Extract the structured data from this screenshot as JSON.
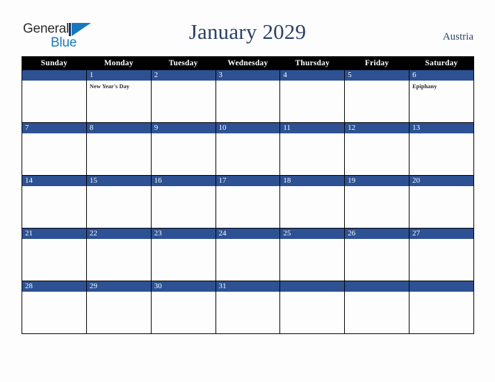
{
  "brand": {
    "name_part1": "General",
    "name_part2": "Blue",
    "logo_icon": "triangle-flag-icon",
    "color_dark": "#2b2b2b",
    "color_blue": "#1878be"
  },
  "header": {
    "title": "January 2029",
    "country": "Austria",
    "title_color": "#2b4166"
  },
  "calendar": {
    "month": "January",
    "year": "2029",
    "accent_color": "#2d5193",
    "header_bg": "#000000",
    "weekday_headers": [
      "Sunday",
      "Monday",
      "Tuesday",
      "Wednesday",
      "Thursday",
      "Friday",
      "Saturday"
    ],
    "weeks": [
      [
        {
          "date": "",
          "events": []
        },
        {
          "date": "1",
          "events": [
            "New Year's Day"
          ]
        },
        {
          "date": "2",
          "events": []
        },
        {
          "date": "3",
          "events": []
        },
        {
          "date": "4",
          "events": []
        },
        {
          "date": "5",
          "events": []
        },
        {
          "date": "6",
          "events": [
            "Epiphany"
          ]
        }
      ],
      [
        {
          "date": "7",
          "events": []
        },
        {
          "date": "8",
          "events": []
        },
        {
          "date": "9",
          "events": []
        },
        {
          "date": "10",
          "events": []
        },
        {
          "date": "11",
          "events": []
        },
        {
          "date": "12",
          "events": []
        },
        {
          "date": "13",
          "events": []
        }
      ],
      [
        {
          "date": "14",
          "events": []
        },
        {
          "date": "15",
          "events": []
        },
        {
          "date": "16",
          "events": []
        },
        {
          "date": "17",
          "events": []
        },
        {
          "date": "18",
          "events": []
        },
        {
          "date": "19",
          "events": []
        },
        {
          "date": "20",
          "events": []
        }
      ],
      [
        {
          "date": "21",
          "events": []
        },
        {
          "date": "22",
          "events": []
        },
        {
          "date": "23",
          "events": []
        },
        {
          "date": "24",
          "events": []
        },
        {
          "date": "25",
          "events": []
        },
        {
          "date": "26",
          "events": []
        },
        {
          "date": "27",
          "events": []
        }
      ],
      [
        {
          "date": "28",
          "events": []
        },
        {
          "date": "29",
          "events": []
        },
        {
          "date": "30",
          "events": []
        },
        {
          "date": "31",
          "events": []
        },
        {
          "date": "",
          "events": []
        },
        {
          "date": "",
          "events": []
        },
        {
          "date": "",
          "events": []
        }
      ]
    ]
  }
}
